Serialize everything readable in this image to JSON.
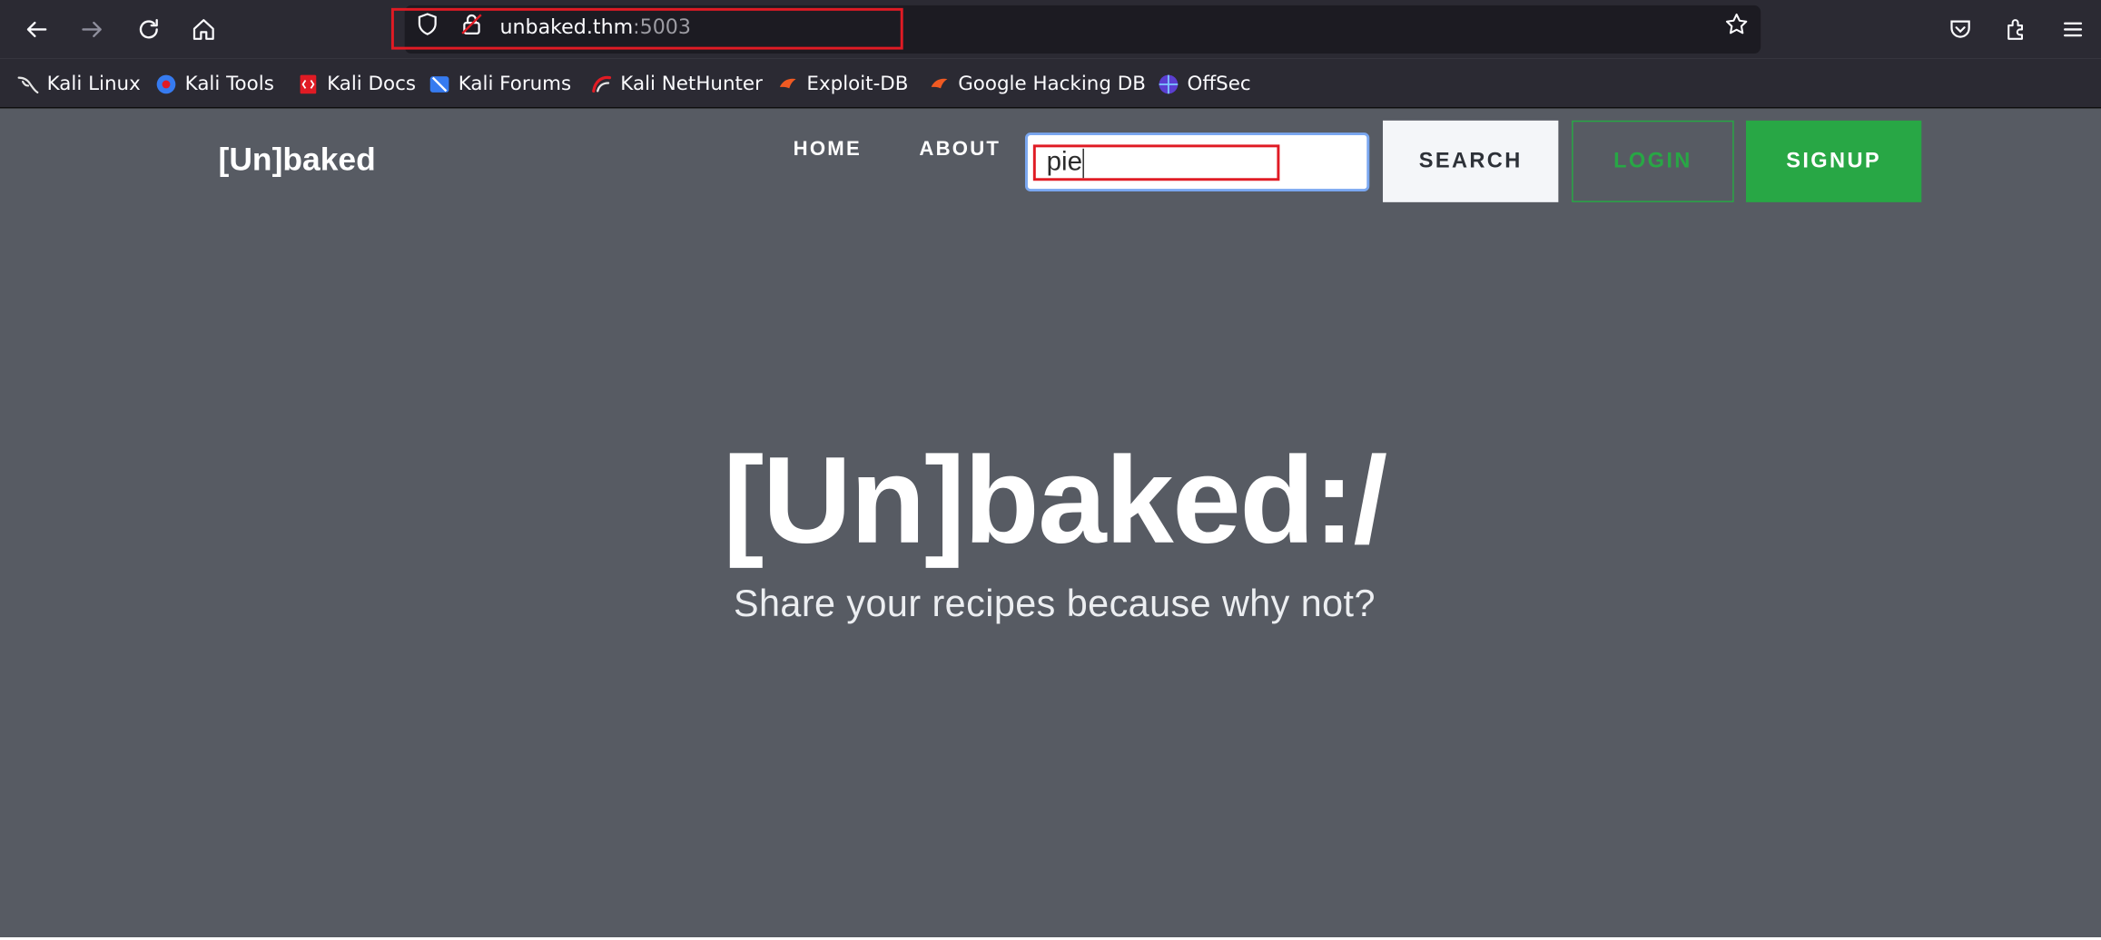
{
  "browser": {
    "url_host": "unbaked.thm",
    "url_port": ":5003",
    "bookmarks": [
      {
        "label": "Kali Linux",
        "icon": "kali-dragon-icon"
      },
      {
        "label": "Kali Tools",
        "icon": "kali-tools-icon"
      },
      {
        "label": "Kali Docs",
        "icon": "kali-docs-icon"
      },
      {
        "label": "Kali Forums",
        "icon": "kali-forums-icon"
      },
      {
        "label": "Kali NetHunter",
        "icon": "kali-nethunter-icon"
      },
      {
        "label": "Exploit-DB",
        "icon": "exploit-db-icon"
      },
      {
        "label": "Google Hacking DB",
        "icon": "ghdb-icon"
      },
      {
        "label": "OffSec",
        "icon": "offsec-icon"
      }
    ]
  },
  "site": {
    "brand": "[Un]baked",
    "nav": {
      "home": "HOME",
      "about": "ABOUT"
    },
    "search": {
      "value": "pie",
      "button": "SEARCH"
    },
    "login": "LOGIN",
    "signup": "SIGNUP",
    "hero": {
      "title": "[Un]baked:/",
      "subtitle": "Share your recipes because why not?"
    },
    "colors": {
      "background": "#575b63",
      "accent_green": "#28a745",
      "highlight_red": "#e01b24"
    }
  }
}
